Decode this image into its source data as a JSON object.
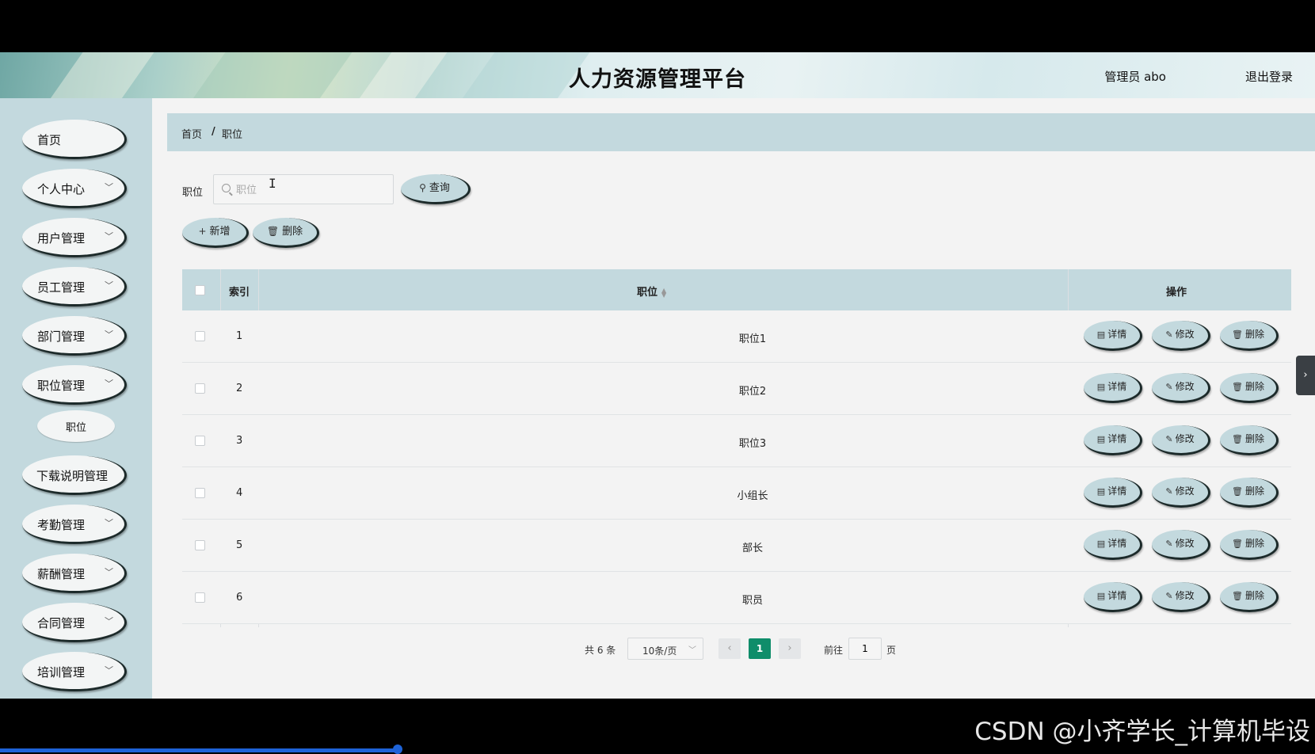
{
  "header": {
    "title": "人力资源管理平台",
    "user": "管理员 abo",
    "logout": "退出登录"
  },
  "sidebar": {
    "items": [
      {
        "label": "首页",
        "has_chevron": false
      },
      {
        "label": "个人中心",
        "has_chevron": true
      },
      {
        "label": "用户管理",
        "has_chevron": true
      },
      {
        "label": "员工管理",
        "has_chevron": true
      },
      {
        "label": "部门管理",
        "has_chevron": true
      },
      {
        "label": "职位管理",
        "has_chevron": true
      },
      {
        "label": "下载说明管理",
        "has_chevron": false
      },
      {
        "label": "考勤管理",
        "has_chevron": true
      },
      {
        "label": "薪酬管理",
        "has_chevron": true
      },
      {
        "label": "合同管理",
        "has_chevron": true
      },
      {
        "label": "培训管理",
        "has_chevron": true
      }
    ],
    "sub_item": "职位"
  },
  "breadcrumb": {
    "home": "首页",
    "sep": "/",
    "current": "职位"
  },
  "search": {
    "label": "职位",
    "placeholder": "职位",
    "button": "查询"
  },
  "actions": {
    "add": "新增",
    "delete": "删除"
  },
  "table": {
    "headers": {
      "index": "索引",
      "position": "职位",
      "ops": "操作"
    },
    "rows": [
      {
        "index": "1",
        "position": "职位1"
      },
      {
        "index": "2",
        "position": "职位2"
      },
      {
        "index": "3",
        "position": "职位3"
      },
      {
        "index": "4",
        "position": "小组长"
      },
      {
        "index": "5",
        "position": "部长"
      },
      {
        "index": "6",
        "position": "职员"
      }
    ],
    "op_labels": {
      "detail": "详情",
      "edit": "修改",
      "delete": "删除"
    }
  },
  "pagination": {
    "total": "共 6 条",
    "page_size": "10条/页",
    "current_page": "1",
    "goto_label": "前往",
    "goto_value": "1",
    "page_unit": "页"
  },
  "watermark": "CSDN @小齐学长_计算机毕设",
  "colors": {
    "accent": "#c3d9de",
    "page_active": "#0f8d6a",
    "progress": "#1e63d8"
  }
}
